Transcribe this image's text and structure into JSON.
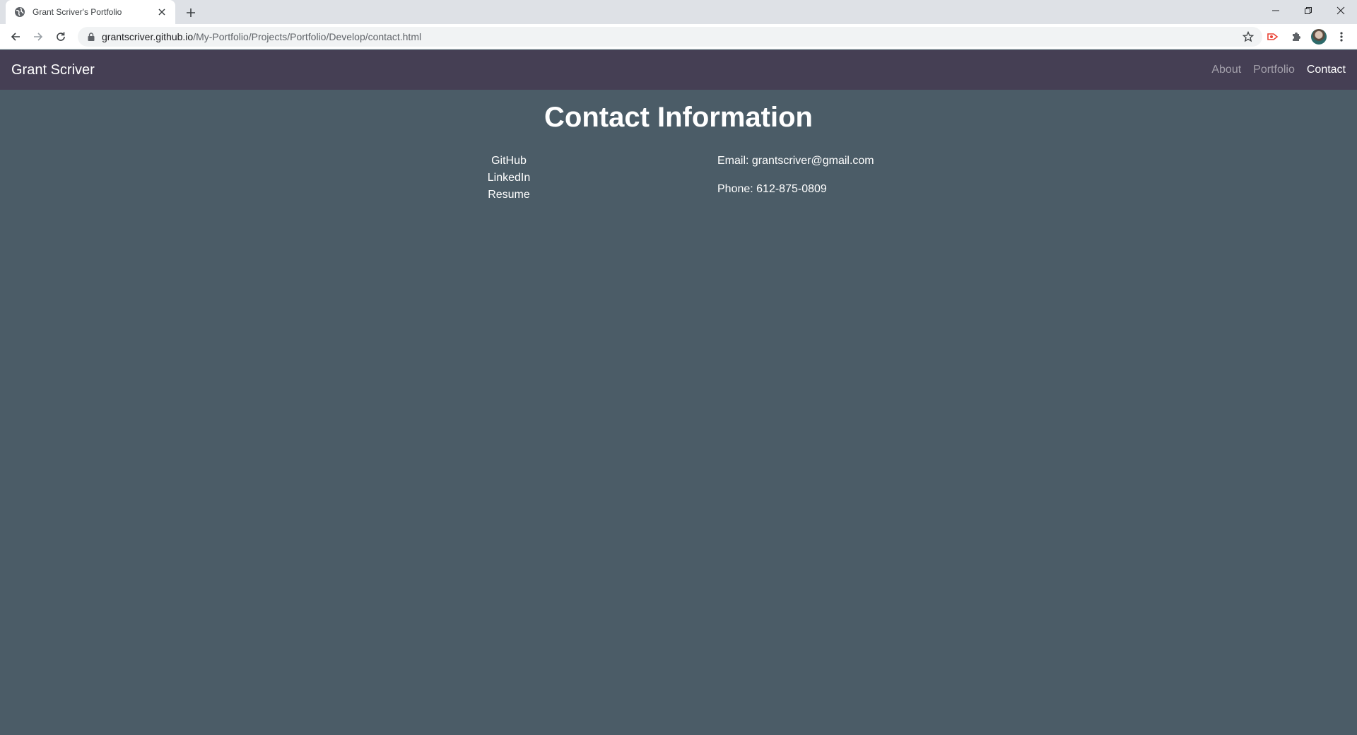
{
  "browser": {
    "tab_title": "Grant Scriver's Portfolio",
    "url_host": "grantscriver.github.io",
    "url_path": "/My-Portfolio/Projects/Portfolio/Develop/contact.html"
  },
  "site": {
    "brand": "Grant Scriver",
    "nav": [
      {
        "label": "About"
      },
      {
        "label": "Portfolio"
      },
      {
        "label": "Contact"
      }
    ]
  },
  "contact": {
    "title": "Contact Information",
    "links": [
      "GitHub",
      "LinkedIn",
      "Resume"
    ],
    "email": "Email: grantscriver@gmail.com",
    "phone": "Phone: 612-875-0809"
  },
  "colors": {
    "page_bg": "#4b5c67",
    "navbar_bg": "#453f54"
  }
}
